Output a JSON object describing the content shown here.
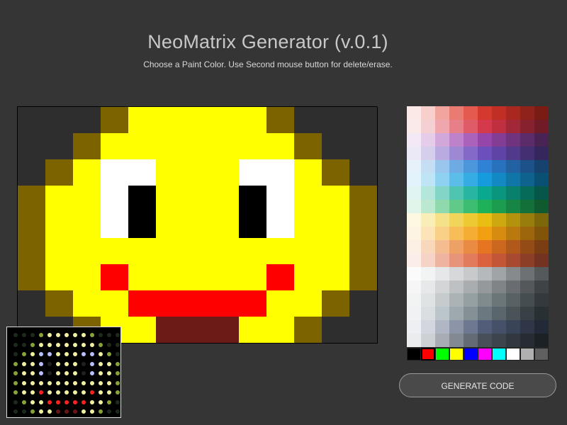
{
  "header": {
    "title": "NeoMatrix Generator (v.0.1)",
    "subtitle": "Choose a Paint Color. Use Second mouse button for delete/erase."
  },
  "matrix": {
    "cols": 13,
    "rows": 9,
    "legend": {
      "D": "#2e2e2e",
      "O": "#7d6200",
      "Y": "#ffff00",
      "W": "#ffffff",
      "K": "#000000",
      "R": "#ff0000",
      "B": "#6b1c16"
    },
    "pixels": [
      "DDDOYYYYYODDD",
      "DDOYYYYYYYODD",
      "DOYWWYYYWWYOD",
      "OYYWKYYYKWYYO",
      "OYYWKYYYKWYYO",
      "OYYYYYYYYYYYO",
      "OYYRYYYYYRYYO",
      "DOYYRRRRRYYOD",
      "DDOYYBBBYYODD"
    ]
  },
  "palette": {
    "swatches": [
      [
        "#fbe9e7",
        "#f7cfcb",
        "#f1a59e",
        "#ea7b72",
        "#e45a4e",
        "#d5382c",
        "#c02e24",
        "#a8281f",
        "#8f2219",
        "#7a1c14"
      ],
      [
        "#fbeaea",
        "#f5d0d3",
        "#efa7ad",
        "#e77f88",
        "#e05b68",
        "#d53a4c",
        "#bf2f40",
        "#a32837",
        "#88212e",
        "#701b26"
      ],
      [
        "#f3e9f5",
        "#e5cdea",
        "#d2a8da",
        "#bd82c9",
        "#aa62ba",
        "#9646a8",
        "#843d95",
        "#70347f",
        "#5c2b69",
        "#4a2355"
      ],
      [
        "#ece9f6",
        "#d6cfec",
        "#b9abe0",
        "#9c88d3",
        "#8469c8",
        "#6d4fbb",
        "#5f44a5",
        "#513a8c",
        "#423073",
        "#35275d"
      ],
      [
        "#e6f1fa",
        "#c5def4",
        "#9ac5ec",
        "#6fabe3",
        "#4c96dc",
        "#2f82d4",
        "#2872bd",
        "#2262a3",
        "#1c5289",
        "#164270"
      ],
      [
        "#e3f3fb",
        "#bfe4f6",
        "#8ed1f0",
        "#5dbde9",
        "#35ace3",
        "#169bdc",
        "#1389c3",
        "#1076a8",
        "#0d638d",
        "#0a5074"
      ],
      [
        "#e0f4f1",
        "#b5e6de",
        "#82d5c7",
        "#4fc4b1",
        "#28b6a0",
        "#0aa88e",
        "#09957e",
        "#08806c",
        "#076b5a",
        "#065749"
      ],
      [
        "#e2f5ea",
        "#bce8cf",
        "#8fd9ad",
        "#61ca8b",
        "#3dbd71",
        "#1fb05a",
        "#1b9c4f",
        "#178644",
        "#137039",
        "#0f5a2e"
      ],
      [
        "#fdf8e2",
        "#f9edb8",
        "#f5e189",
        "#f1d45a",
        "#edc934",
        "#e9be12",
        "#cea810",
        "#b3920e",
        "#987c0c",
        "#7e670a"
      ],
      [
        "#fef4e3",
        "#fce3b8",
        "#f9d088",
        "#f7bd58",
        "#f5ae33",
        "#f39f12",
        "#d78c10",
        "#ba790e",
        "#9d660c",
        "#82540a"
      ],
      [
        "#fcefe3",
        "#f8d8bd",
        "#f3bd91",
        "#eea165",
        "#ea8b43",
        "#e67522",
        "#cb671e",
        "#b0591a",
        "#944b16",
        "#7a3e12"
      ],
      [
        "#fbeee8",
        "#f5d4c7",
        "#eeb4a0",
        "#e79479",
        "#e17b5b",
        "#db623e",
        "#c25636",
        "#a84a2f",
        "#8d3e27",
        "#743320"
      ],
      [
        "#fbfbfb",
        "#f2f3f3",
        "#e6e7e8",
        "#d6d8d9",
        "#c7c9cb",
        "#b6b9bb",
        "#a0a4a6",
        "#868a8d",
        "#6d7174",
        "#56595c"
      ],
      [
        "#f6f6f6",
        "#e7e8e9",
        "#d3d5d6",
        "#bec1c3",
        "#a9adb0",
        "#95999c",
        "#7f8487",
        "#696d71",
        "#54585b",
        "#404346"
      ],
      [
        "#f2f4f4",
        "#dfe3e4",
        "#c6cccd",
        "#abb3b5",
        "#94a0a2",
        "#7f8b8d",
        "#6b7679",
        "#586164",
        "#454d50",
        "#33393c"
      ],
      [
        "#f0f2f3",
        "#d9dfe1",
        "#bcc5c9",
        "#9ea9af",
        "#848f96",
        "#6b787f",
        "#5a666c",
        "#495358",
        "#384145",
        "#283034"
      ],
      [
        "#eeeff2",
        "#d3d6de",
        "#b0b6c4",
        "#8c94a8",
        "#6e7890",
        "#525e79",
        "#465169",
        "#3a4458",
        "#2e3647",
        "#222937"
      ],
      [
        "#ebeced",
        "#ced1d4",
        "#a8adb3",
        "#828991",
        "#636b75",
        "#475059",
        "#3c444c",
        "#31383f",
        "#262c32",
        "#1c2126"
      ]
    ],
    "basic_colors": [
      "#000000",
      "#ff0000",
      "#00ff00",
      "#ffff00",
      "#0000ff",
      "#ff00ff",
      "#00ffff",
      "#ffffff",
      "#b0b0b0",
      "#606060"
    ]
  },
  "actions": {
    "generate_label": "GENERATE CODE"
  },
  "preview": {
    "led_colors": {
      "D": "#1c2a1c",
      "O": "#8aa336",
      "Y": "#f0f0a0",
      "W": "#b8c0ff",
      "K": "#202020",
      "R": "#ff2020",
      "B": "#6a1515"
    }
  }
}
